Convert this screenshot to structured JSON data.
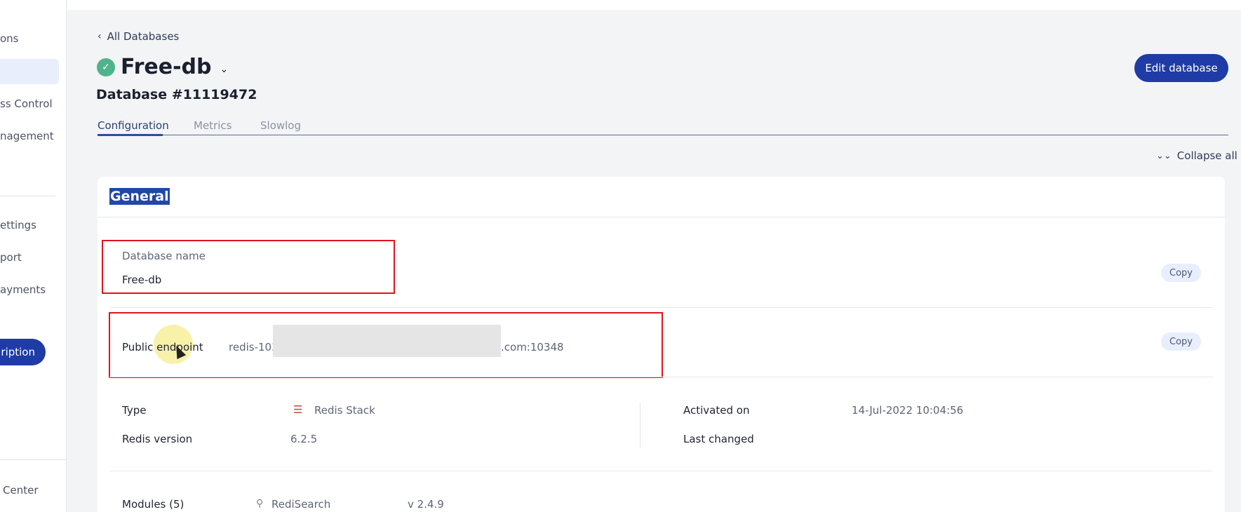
{
  "sidebar": {
    "items": [
      {
        "label": "ons"
      },
      {
        "label": ""
      },
      {
        "label": "ss Control"
      },
      {
        "label": "nagement"
      },
      {
        "label": "ettings"
      },
      {
        "label": "port"
      },
      {
        "label": "ayments"
      }
    ],
    "subscription_button": "ription",
    "footer_item": "Center"
  },
  "header": {
    "back_link": "All Databases",
    "db_title": "Free-db",
    "db_number": "Database #11119472",
    "edit_button": "Edit database"
  },
  "tabs": [
    {
      "label": "Configuration",
      "active": true
    },
    {
      "label": "Metrics",
      "active": false
    },
    {
      "label": "Slowlog",
      "active": false
    }
  ],
  "collapse_all": "Collapse all",
  "general": {
    "title": "General",
    "database_name_label": "Database name",
    "database_name_value": "Free-db",
    "public_endpoint_label": "Public endpoint",
    "public_endpoint_prefix": "redis-103",
    "public_endpoint_suffix": ".com:10348",
    "copy_label": "Copy",
    "type_label": "Type",
    "type_value": "Redis Stack",
    "redis_version_label": "Redis version",
    "redis_version_value": "6.2.5",
    "activated_on_label": "Activated on",
    "activated_on_value": "14-Jul-2022 10:04:56",
    "last_changed_label": "Last changed",
    "modules_label": "Modules (5)",
    "module_name": "RediSearch",
    "module_version": "v 2.4.9"
  },
  "colors": {
    "primary": "#1f3ba6",
    "status_green": "#4fb38c",
    "highlight_red": "#e0141e"
  }
}
